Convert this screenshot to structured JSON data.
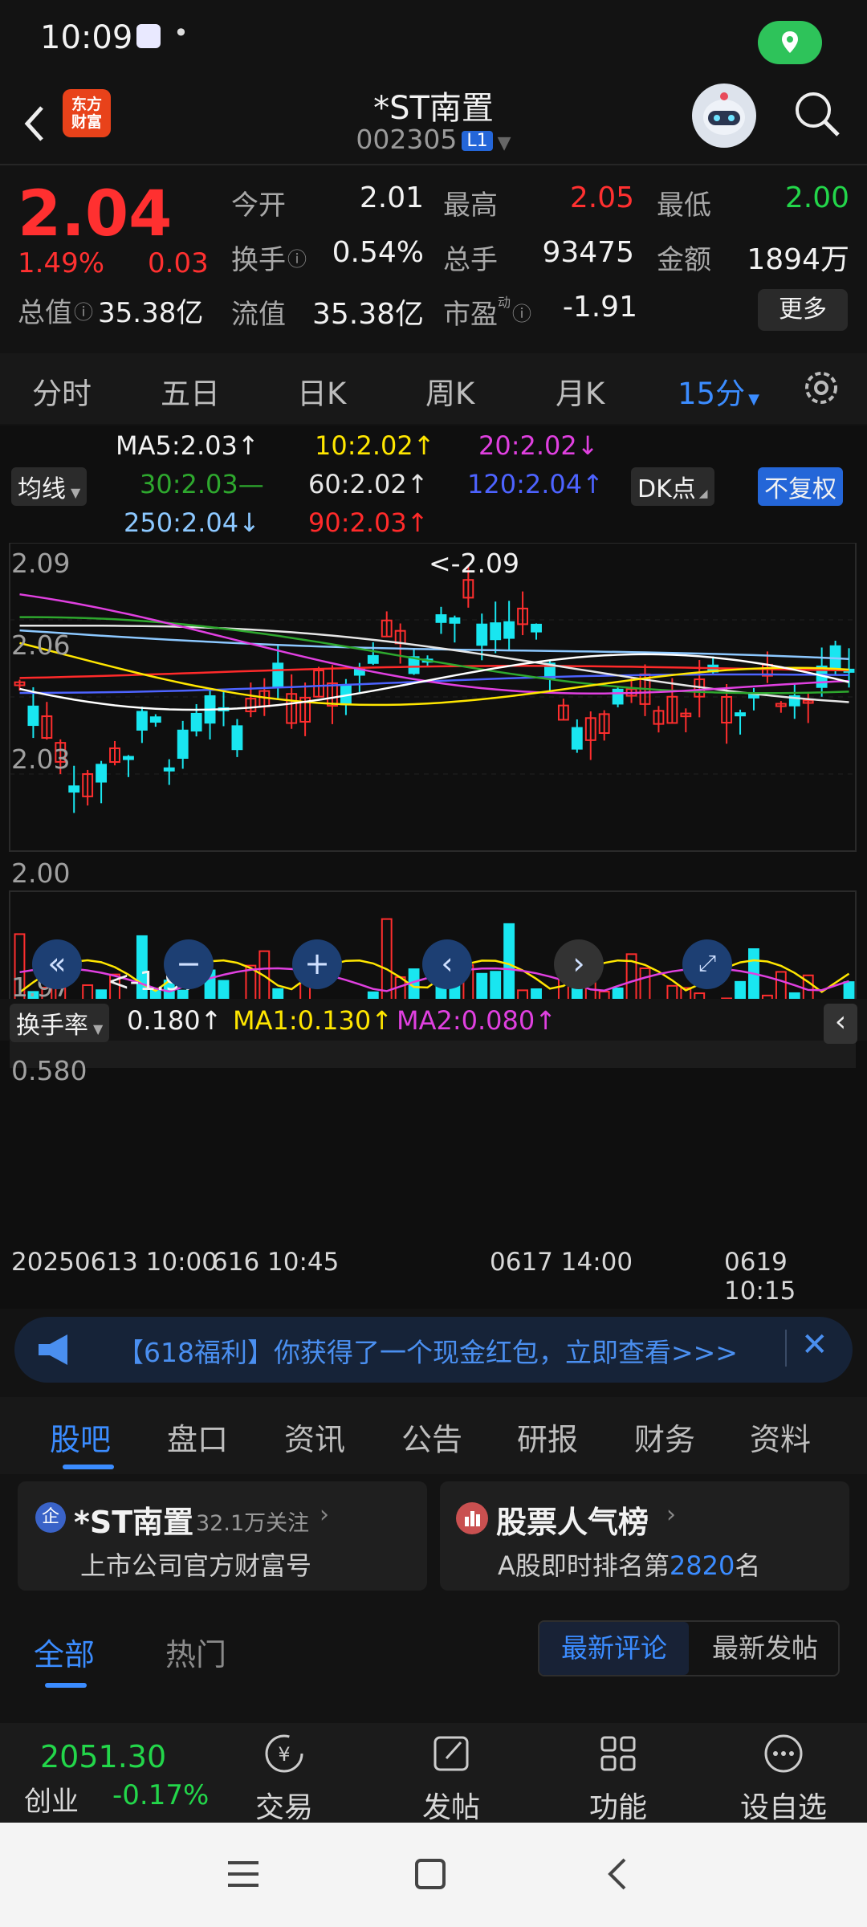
{
  "status_bar": {
    "time": "10:09",
    "dot": "•"
  },
  "header": {
    "logo_line1": "东方",
    "logo_line2": "财富",
    "name": "*ST南置",
    "code": "002305",
    "badge": "L1"
  },
  "quote": {
    "price": "2.04",
    "change_pct": "1.49%",
    "change": "0.03",
    "market_cap_label": "总值",
    "market_cap": "35.38亿",
    "open_label": "今开",
    "open": "2.01",
    "high_label": "最高",
    "high": "2.05",
    "low_label": "最低",
    "low": "2.00",
    "turnover_label": "换手",
    "turnover": "0.54%",
    "volume_label": "总手",
    "volume": "93475",
    "amount_label": "金额",
    "amount": "1894万",
    "float_cap_label": "流值",
    "float_cap": "35.38亿",
    "pe_label": "市盈",
    "pe_sup": "动",
    "pe": "-1.91",
    "more_label": "更多"
  },
  "period_tabs": [
    "分时",
    "五日",
    "日K",
    "周K",
    "月K",
    "15分"
  ],
  "chart": {
    "ma_selector": "均线",
    "ma5": "MA5:2.03↑",
    "ma10": "10:2.02↑",
    "ma20": "20:2.02↓",
    "ma30": "30:2.03—",
    "ma60": "60:2.02↑",
    "ma120": "120:2.04↑",
    "ma250": "250:2.04↓",
    "ma90": "90:2.03↑",
    "dk_label": "DK点",
    "adjust_label": "不复权",
    "y_ticks": [
      "2.09",
      "2.06",
      "2.03",
      "2.00",
      "1.97"
    ],
    "high_marker": "<-2.09",
    "low_marker": "<-1.97",
    "indicator_selector": "换手率",
    "ind_value": "0.180↑",
    "ind_ma1": "MA1:0.130↑",
    "ind_ma2": "MA2:0.080↑",
    "ind_top": "0.580",
    "x_labels": [
      "20250613 10:00",
      "616 10:45",
      "0617 14:00",
      "0619 10:15"
    ],
    "colors": {
      "ma5": "#ffffff",
      "ma10": "#ffe600",
      "ma20": "#e040e0",
      "ma30": "#2ea82e",
      "ma60": "#e6e6e6",
      "ma120": "#4d63ff",
      "ma250": "#8cc8ff",
      "ma90": "#ff2a2a",
      "up": "#ff2e2e",
      "down": "#19e6f0"
    }
  },
  "banner": {
    "text": "【618福利】你获得了一个现金红包，立即查看>>>"
  },
  "news_tabs": [
    "股吧",
    "盘口",
    "资讯",
    "公告",
    "研报",
    "财务",
    "资料"
  ],
  "cards": {
    "left_badge": "企",
    "left_title": "*ST南置",
    "left_followers": "32.1万关注",
    "left_sub": "上市公司官方财富号",
    "right_title": "股票人气榜",
    "right_sub_pre": "A股即时排名第",
    "right_rank": "2820",
    "right_sub_post": "名"
  },
  "filter": {
    "all": "全部",
    "hot": "热门",
    "latest_comment": "最新评论",
    "latest_post": "最新发帖"
  },
  "bottom_nav": {
    "index_value": "2051.30",
    "index_name": "创业",
    "index_change": "-0.17%",
    "trade": "交易",
    "post": "发帖",
    "func": "功能",
    "watch": "设自选"
  }
}
